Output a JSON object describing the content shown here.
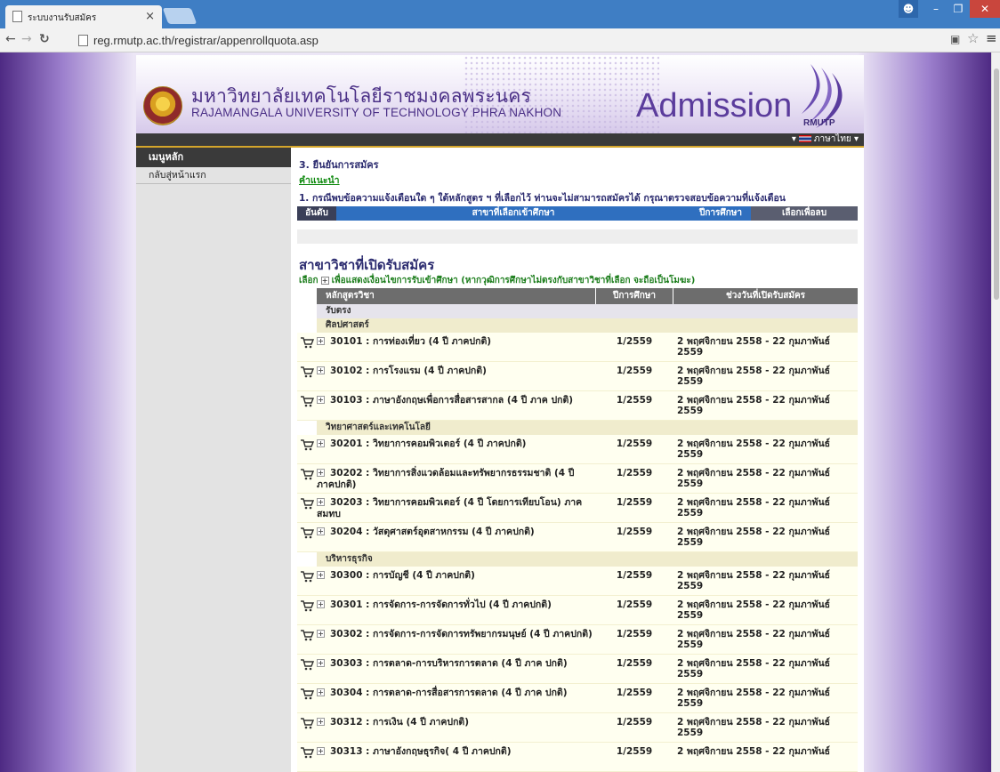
{
  "browser": {
    "tab_title": "ระบบงานรับสมัคร",
    "tab_close": "×",
    "url": "reg.rmutp.ac.th/registrar/appenrollquota.asp"
  },
  "header": {
    "university_th": "มหาวิทยาลัยเทคโนโลยีราชมงคลพระนคร",
    "university_en": "RAJAMANGALA UNIVERSITY OF TECHNOLOGY PHRA NAKHON",
    "admission": "Admission",
    "brand_short": "RMUTP",
    "language": "ภาษาไทย"
  },
  "sidebar": {
    "heading": "เมนูหลัก",
    "items": [
      {
        "label": "กลับสู่หน้าแรก"
      }
    ]
  },
  "main": {
    "section_title": "3. ยืนยันการสมัคร",
    "advice_link": "คำแนะนำ",
    "advice_text": "1. กรณีพบข้อความแจ้งเตือนใด ๆ ใต้หลักสูตร ฯ ที่เลือกไว้ ท่านจะไม่สามารถสมัครได้ กรุณาตรวจสอบข้อความที่แจ้งเตือน",
    "selected_headers": [
      "อันดับ",
      "สาขาที่เลือกเข้าศึกษา",
      "ปีการศึกษา",
      "เลือกเพื่อลบ"
    ],
    "open_title": "สาขาวิชาที่เปิดรับสมัคร",
    "open_sub_pre": "เลือก",
    "open_sub_post": "เพื่อแสดงเงื่อนไขการรับเข้าศึกษา (หากวุฒิการศึกษาไม่ตรงกับสาขาวิชาที่เลือก จะถือเป็นโมฆะ)",
    "table_headers": [
      "หลักสูตรวิชา",
      "ปีการศึกษา",
      "ช่วงวันที่เปิดรับสมัคร"
    ],
    "admission_type": "รับตรง",
    "groups": [
      {
        "name": "ศิลปศาสตร์",
        "courses": [
          {
            "name": "30101 : การท่องเที่ยว (4 ปี ภาคปกติ)",
            "term": "1/2559",
            "dates": "2 พฤศจิกายน 2558 - 22 กุมภาพันธ์ 2559"
          },
          {
            "name": "30102 : การโรงแรม (4 ปี ภาคปกติ)",
            "term": "1/2559",
            "dates": "2 พฤศจิกายน 2558 - 22 กุมภาพันธ์ 2559"
          },
          {
            "name": "30103 : ภาษาอังกฤษเพื่อการสื่อสารสากล (4 ปี ภาค ปกติ)",
            "term": "1/2559",
            "dates": "2 พฤศจิกายน 2558 - 22 กุมภาพันธ์ 2559"
          }
        ]
      },
      {
        "name": "วิทยาศาสตร์และเทคโนโลยี",
        "courses": [
          {
            "name": "30201 : วิทยาการคอมพิวเตอร์ (4 ปี ภาคปกติ)",
            "term": "1/2559",
            "dates": "2 พฤศจิกายน 2558 - 22 กุมภาพันธ์ 2559"
          },
          {
            "name": "30202 : วิทยาการสิ่งแวดล้อมและทรัพยากรธรรมชาติ (4 ปี ภาคปกติ)",
            "term": "1/2559",
            "dates": "2 พฤศจิกายน 2558 - 22 กุมภาพันธ์ 2559"
          },
          {
            "name": "30203 : วิทยาการคอมพิวเตอร์ (4 ปี โดยการเทียบโอน) ภาคสมทบ",
            "term": "1/2559",
            "dates": "2 พฤศจิกายน 2558 - 22 กุมภาพันธ์ 2559"
          },
          {
            "name": "30204 : วัสดุศาสตร์อุตสาหกรรม (4 ปี ภาคปกติ)",
            "term": "1/2559",
            "dates": "2 พฤศจิกายน 2558 - 22 กุมภาพันธ์ 2559"
          }
        ]
      },
      {
        "name": "บริหารธุรกิจ",
        "courses": [
          {
            "name": "30300 : การบัญชี (4 ปี ภาคปกติ)",
            "term": "1/2559",
            "dates": "2 พฤศจิกายน 2558 - 22 กุมภาพันธ์ 2559"
          },
          {
            "name": "30301 : การจัดการ-การจัดการทั่วไป (4 ปี ภาคปกติ)",
            "term": "1/2559",
            "dates": "2 พฤศจิกายน 2558 - 22 กุมภาพันธ์ 2559"
          },
          {
            "name": "30302 : การจัดการ-การจัดการทรัพยากรมนุษย์ (4 ปี ภาคปกติ)",
            "term": "1/2559",
            "dates": "2 พฤศจิกายน 2558 - 22 กุมภาพันธ์ 2559"
          },
          {
            "name": "30303 : การตลาด-การบริหารการตลาด (4 ปี ภาค ปกติ)",
            "term": "1/2559",
            "dates": "2 พฤศจิกายน 2558 - 22 กุมภาพันธ์ 2559"
          },
          {
            "name": "30304 : การตลาด-การสื่อสารการตลาด (4 ปี ภาค ปกติ)",
            "term": "1/2559",
            "dates": "2 พฤศจิกายน 2558 - 22 กุมภาพันธ์ 2559"
          },
          {
            "name": "30312 : การเงิน (4 ปี ภาคปกติ)",
            "term": "1/2559",
            "dates": "2 พฤศจิกายน 2558 - 22 กุมภาพันธ์ 2559"
          },
          {
            "name": "30313 : ภาษาอังกฤษธุรกิจ( 4 ปี ภาคปกติ)",
            "term": "1/2559",
            "dates": "2 พฤศจิกายน 2558 - 22 กุมภาพันธ์"
          }
        ]
      }
    ]
  },
  "icons": {
    "cart": "cart-icon",
    "expand": "plus-box-icon",
    "star": "star-icon",
    "menu": "hamburger-menu-icon"
  },
  "colors": {
    "tabbar": "#3f7ec4",
    "heading_text": "#2b2b6f",
    "link_green": "#108a10",
    "row_bg": "#fffff0",
    "group_bg": "#f0eccd"
  }
}
